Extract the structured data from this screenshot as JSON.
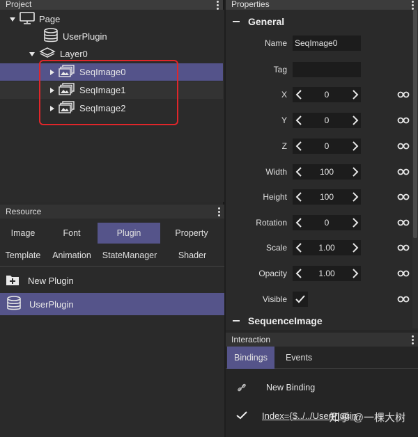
{
  "project": {
    "title": "Project",
    "tree": [
      {
        "label": "Page",
        "icon": "monitor-icon",
        "expanded": true
      },
      {
        "label": "UserPlugin",
        "icon": "database-icon"
      },
      {
        "label": "Layer0",
        "icon": "layers-icon",
        "expanded": true
      },
      {
        "label": "SeqImage0",
        "icon": "image-sequence-icon",
        "selected": true
      },
      {
        "label": "SeqImage1",
        "icon": "image-sequence-icon"
      },
      {
        "label": "SeqImage2",
        "icon": "image-sequence-icon"
      }
    ]
  },
  "resource": {
    "title": "Resource",
    "tabs_row1": [
      "Image",
      "Font",
      "Plugin",
      "Property"
    ],
    "tabs_row2": [
      "Template",
      "Animation",
      "StateManager",
      "Shader"
    ],
    "active_tab": "Plugin",
    "new_plugin": "New Plugin",
    "items": [
      "UserPlugin"
    ]
  },
  "properties": {
    "title": "Properties",
    "general_label": "General",
    "name_label": "Name",
    "name_value": "SeqImage0",
    "tag_label": "Tag",
    "tag_value": "",
    "fields": [
      {
        "label": "X",
        "value": "0"
      },
      {
        "label": "Y",
        "value": "0"
      },
      {
        "label": "Z",
        "value": "0"
      },
      {
        "label": "Width",
        "value": "100"
      },
      {
        "label": "Height",
        "value": "100"
      },
      {
        "label": "Rotation",
        "value": "0"
      },
      {
        "label": "Scale",
        "value": "1.00"
      },
      {
        "label": "Opacity",
        "value": "1.00"
      }
    ],
    "visible_label": "Visible",
    "visible_checked": true,
    "sequence_label": "SequenceImage"
  },
  "interaction": {
    "title": "Interaction",
    "tabs": [
      "Bindings",
      "Events"
    ],
    "active_tab": "Bindings",
    "new_binding": "New Binding",
    "binding_expr": "Index={$../../UserPlugin"
  },
  "watermark": "知乎 @一棵大树",
  "colors": {
    "selection": "#54538a",
    "highlight": "#e0262a"
  }
}
